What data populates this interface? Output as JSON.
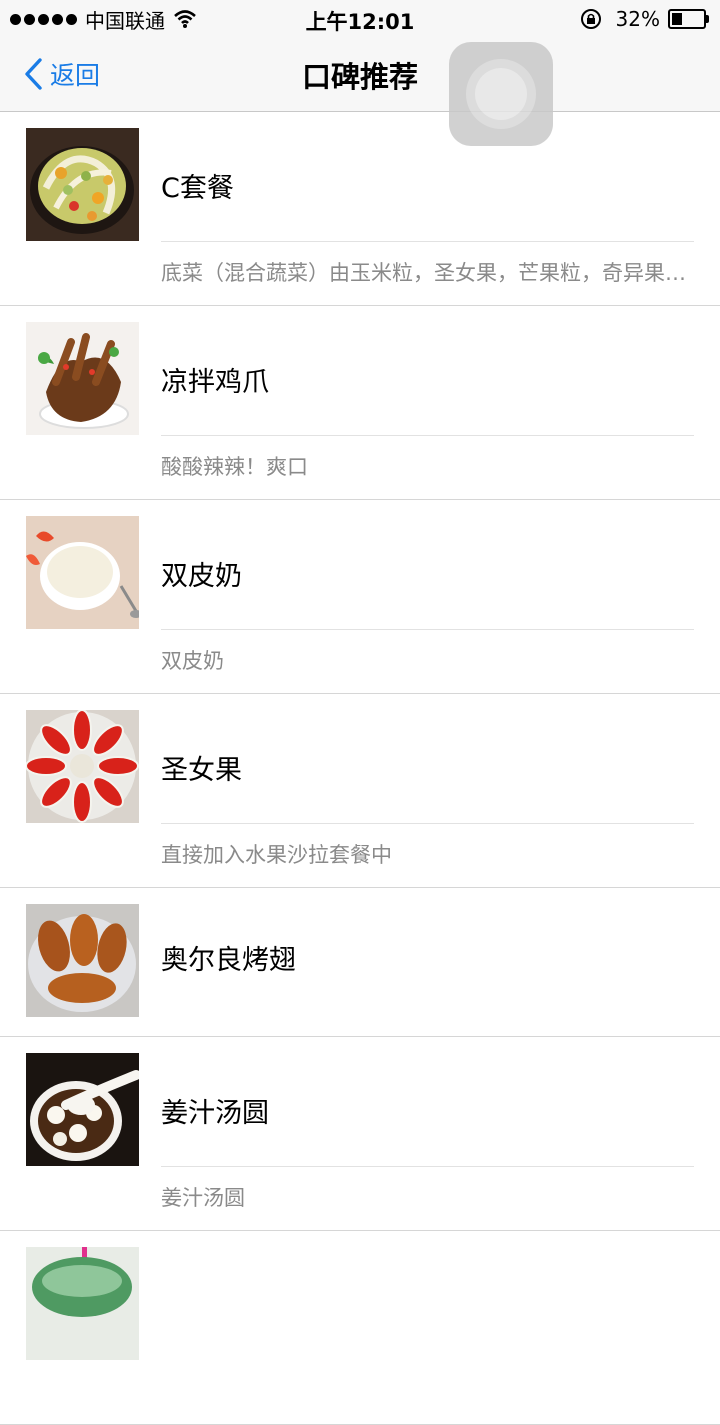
{
  "status_bar": {
    "carrier": "中国联通",
    "time": "上午12:01",
    "battery_percent": "32%",
    "battery_level": 0.32,
    "icons": [
      "signal-dots-icon",
      "wifi-icon",
      "orientation-lock-icon",
      "battery-icon"
    ]
  },
  "nav": {
    "back_label": "返回",
    "title": "口碑推荐"
  },
  "items": [
    {
      "name": "C套餐",
      "description": "底菜（混合蔬菜）由玉米粒，圣女果，芒果粒，奇异果组成"
    },
    {
      "name": "凉拌鸡爪",
      "description": "酸酸辣辣！爽口"
    },
    {
      "name": "双皮奶",
      "description": "双皮奶"
    },
    {
      "name": "圣女果",
      "description": "直接加入水果沙拉套餐中"
    },
    {
      "name": "奥尔良烤翅",
      "description": ""
    },
    {
      "name": "姜汁汤圆",
      "description": "姜汁汤圆"
    }
  ]
}
